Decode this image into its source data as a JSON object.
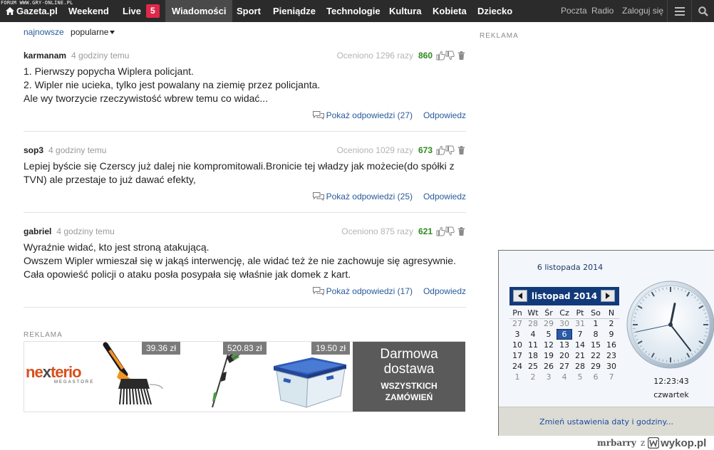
{
  "watermark_top": "FORUM WWW.GRY-ONLINE.PL",
  "topbar": {
    "logo": "Gazeta.pl",
    "nav": [
      "Weekend",
      "Live",
      "Wiadomości",
      "Sport",
      "Pieniądze",
      "Technologie",
      "Kultura",
      "Kobieta",
      "Dziecko"
    ],
    "live_count": "5",
    "active_item": "Wiadomości",
    "util": [
      "Poczta",
      "Radio",
      "Zaloguj się"
    ],
    "menu_icon": "hamburger-icon",
    "search_icon": "search-icon"
  },
  "sort": {
    "newest": "najnowsze",
    "popular": "popularne"
  },
  "comments": [
    {
      "author": "karmanam",
      "time": "4 godziny temu",
      "rated": "Oceniono 1296 razy",
      "score": "860",
      "lines": [
        "1. Pierwszy popycha Wiplera policjant.",
        "2. Wipler nie ucieka, tylko jest powalany na ziemię przez policjanta.",
        "Ale wy tworzycie rzeczywistość wbrew temu co widać..."
      ],
      "replies": "Pokaż odpowiedzi (27)",
      "reply": "Odpowiedz"
    },
    {
      "author": "sop3",
      "time": "4 godziny temu",
      "rated": "Oceniono 1029 razy",
      "score": "673",
      "lines": [
        "Lepiej byście się Czerscy już dalej nie kompromitowali.Bronicie tej władzy jak możecie(do spółki z",
        "TVN) ale przestaje to już dawać efekty,"
      ],
      "replies": "Pokaż odpowiedzi (25)",
      "reply": "Odpowiedz"
    },
    {
      "author": "gabriel",
      "time": "4 godziny temu",
      "rated": "Oceniono 875 razy",
      "score": "621",
      "lines": [
        "Wyraźnie widać, kto jest stroną atakującą.",
        "Owszem Wipler wmieszał się w jakąś interwencję, ale widać też że nie zachowuje się agresywnie.",
        "Cała opowieść policji o ataku posła posypała się właśnie jak domek z kart."
      ],
      "replies": "Pokaż odpowiedzi (17)",
      "reply": "Odpowiedz"
    }
  ],
  "ad": {
    "label": "REKLAMA",
    "brand_a": "ne",
    "brand_x": "x",
    "brand_b": "terio",
    "brand_sub": "MEGASTORE",
    "prices": [
      "39.36 zł",
      "520.83 zł",
      "19.50 zł"
    ],
    "delivery_line1": "Darmowa",
    "delivery_line2": "dostawa",
    "delivery_line3": "WSZYSTKICH",
    "delivery_line4": "ZAMÓWIEŃ"
  },
  "ad_right_label": "REKLAMA",
  "calendar": {
    "date_full": "6 listopada 2014",
    "month": "listopad 2014",
    "weekdays": [
      "Pn",
      "Wt",
      "Śr",
      "Cz",
      "Pt",
      "So",
      "N"
    ],
    "weeks": [
      [
        "27",
        "28",
        "29",
        "30",
        "31",
        "1",
        "2"
      ],
      [
        "3",
        "4",
        "5",
        "6",
        "7",
        "8",
        "9"
      ],
      [
        "10",
        "11",
        "12",
        "13",
        "14",
        "15",
        "16"
      ],
      [
        "17",
        "18",
        "19",
        "20",
        "21",
        "22",
        "23"
      ],
      [
        "24",
        "25",
        "26",
        "27",
        "28",
        "29",
        "30"
      ],
      [
        "1",
        "2",
        "3",
        "4",
        "5",
        "6",
        "7"
      ]
    ],
    "today": "6",
    "time": "12:23:43",
    "day": "czwartek",
    "settings_link": "Zmień ustawienia daty i godziny...",
    "clock": {
      "hours": 12,
      "minutes": 23,
      "seconds": 43
    }
  },
  "watermark_bottom": {
    "user": "mrbarry",
    "z": "z",
    "site": "wykop.pl"
  },
  "colors": {
    "topbar": "#2b2b2b",
    "live_badge": "#e0284a",
    "score": "#2d8a1a",
    "link": "#2a5a9a",
    "calendar_header": "#123a7a"
  }
}
